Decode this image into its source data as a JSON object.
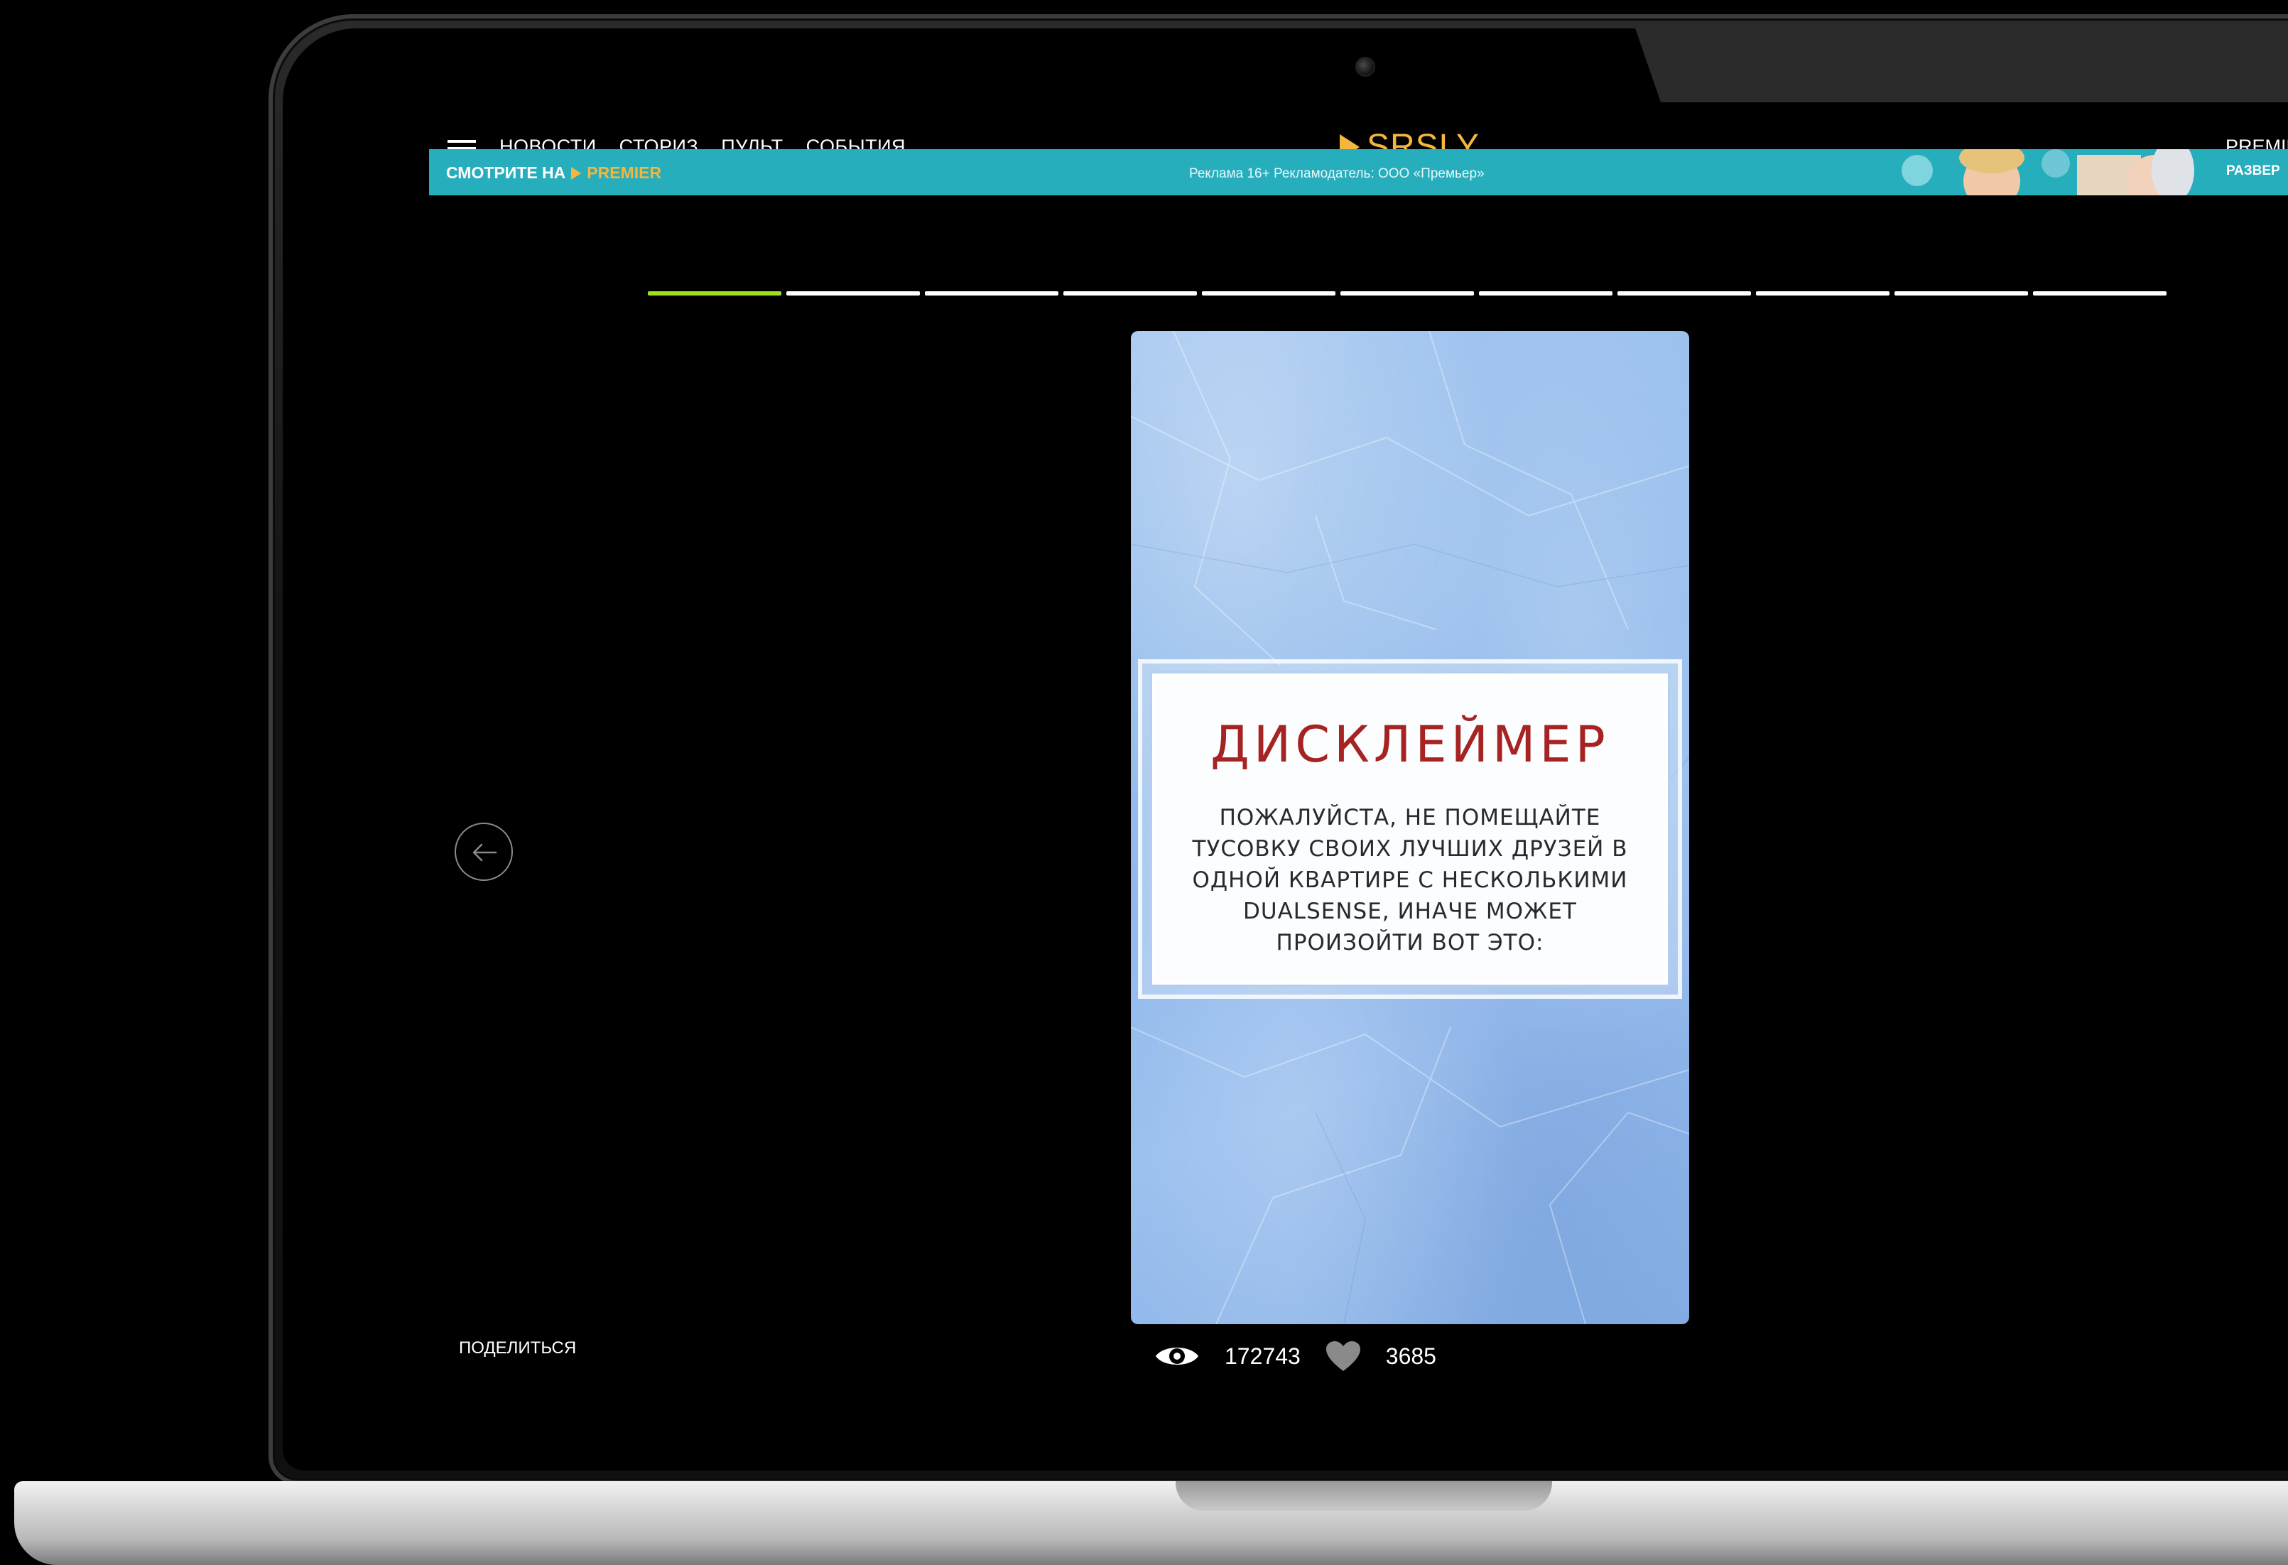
{
  "header": {
    "nav": [
      "НОВОСТИ",
      "СТОРИЗ",
      "ПУЛЬТ",
      "СОБЫТИЯ"
    ],
    "logo": "SRSLY",
    "right_link": "PREMIE"
  },
  "ad_banner": {
    "cta": "СМОТРИТЕ НА",
    "brand": "PREMIER",
    "info": "Реклама 16+   Рекламодатель: ООО «Премьер»",
    "expand": "РАЗВЕР"
  },
  "story": {
    "progress": {
      "total": 11,
      "active_index": 0
    },
    "title": "ДИСКЛЕЙМЕР",
    "text": "ПОЖАЛУЙСТА, НЕ ПОМЕЩАЙТЕ ТУСОВКУ СВОИХ ЛУЧШИХ ДРУЗЕЙ В ОДНОЙ КВАРТИРЕ С НЕСКОЛЬКИМИ DUALSENSE, ИНАЧЕ МОЖЕТ ПРОИЗОЙТИ ВОТ ЭТО:"
  },
  "footer": {
    "share": "ПОДЕЛИТЬСЯ",
    "views": "172743",
    "likes": "3685"
  },
  "colors": {
    "accent_logo": "#f5b63c",
    "ad_banner_bg": "#27aebd",
    "progress_active": "#9be21b",
    "story_bg": "#8bb6ea",
    "disclaimer_title": "#a52322"
  },
  "icons": [
    "menu-icon",
    "play-triangle-icon",
    "arrow-left-icon",
    "eye-icon",
    "heart-icon",
    "camera-icon"
  ]
}
